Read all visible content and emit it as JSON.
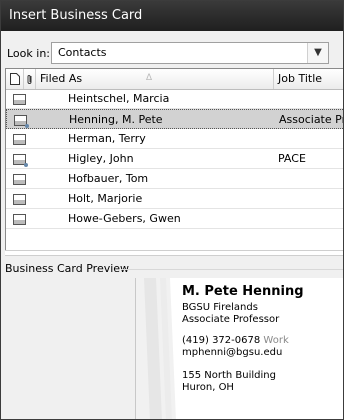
{
  "window": {
    "title": "Insert Business Card"
  },
  "lookin": {
    "label": "Look in:",
    "value": "Contacts"
  },
  "columns": {
    "filed_as": "Filed As",
    "job_title": "Job Title"
  },
  "rows": [
    {
      "name": "Heintschel, Marcia",
      "job": ""
    },
    {
      "name": "Henning, M. Pete",
      "job": "Associate Pro"
    },
    {
      "name": "Herman, Terry",
      "job": ""
    },
    {
      "name": "Higley, John",
      "job": "PACE"
    },
    {
      "name": "Hofbauer, Tom",
      "job": ""
    },
    {
      "name": "Holt, Marjorie",
      "job": ""
    },
    {
      "name": "Howe-Gebers, Gwen",
      "job": ""
    }
  ],
  "preview": {
    "label": "Business Card Preview",
    "name": "M. Pete Henning",
    "org": "BGSU Firelands",
    "title": "Associate Professor",
    "phone": "(419) 372-0678",
    "phone_type": "Work",
    "email": "mphenni@bgsu.edu",
    "addr1": "155 North Building",
    "addr2": "Huron, OH"
  },
  "colors": {
    "titlebar": "#2b2b2b",
    "selected_row": "#d2d2d2"
  }
}
